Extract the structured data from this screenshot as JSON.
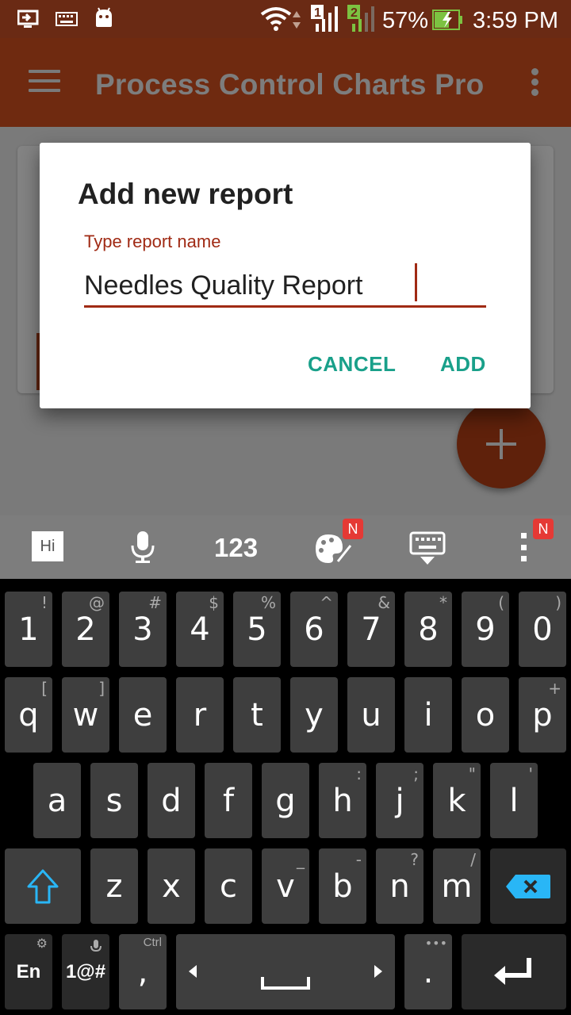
{
  "status_bar": {
    "battery_percent": "57%",
    "time": "3:59 PM",
    "sim1": "1",
    "sim2": "2",
    "icons": [
      "screen-cast-icon",
      "keyboard-icon",
      "android-icon",
      "wifi-icon",
      "signal-sim1-icon",
      "signal-sim2-icon",
      "battery-charging-icon"
    ]
  },
  "app_bar": {
    "title": "Process Control Charts Pro"
  },
  "dialog": {
    "title": "Add new report",
    "field_label": "Type report name",
    "field_value": "Needles Quality Report",
    "cancel_label": "CANCEL",
    "add_label": "ADD"
  },
  "keyboard_toolbar": {
    "hi_label": "Hi",
    "numbers_label": "123",
    "badge_new": "N"
  },
  "keyboard": {
    "row1": [
      {
        "main": "1",
        "sub": "!"
      },
      {
        "main": "2",
        "sub": "@"
      },
      {
        "main": "3",
        "sub": "#"
      },
      {
        "main": "4",
        "sub": "$"
      },
      {
        "main": "5",
        "sub": "%"
      },
      {
        "main": "6",
        "sub": "^"
      },
      {
        "main": "7",
        "sub": "&"
      },
      {
        "main": "8",
        "sub": "*"
      },
      {
        "main": "9",
        "sub": "("
      },
      {
        "main": "0",
        "sub": ")"
      }
    ],
    "row2": [
      {
        "main": "q",
        "sub": "["
      },
      {
        "main": "w",
        "sub": "]"
      },
      {
        "main": "e",
        "sub": ""
      },
      {
        "main": "r",
        "sub": ""
      },
      {
        "main": "t",
        "sub": ""
      },
      {
        "main": "y",
        "sub": ""
      },
      {
        "main": "u",
        "sub": ""
      },
      {
        "main": "i",
        "sub": ""
      },
      {
        "main": "o",
        "sub": ""
      },
      {
        "main": "p",
        "sub": "+"
      }
    ],
    "row3": [
      {
        "main": "a",
        "sub": ""
      },
      {
        "main": "s",
        "sub": ""
      },
      {
        "main": "d",
        "sub": ""
      },
      {
        "main": "f",
        "sub": ""
      },
      {
        "main": "g",
        "sub": ""
      },
      {
        "main": "h",
        "sub": ":"
      },
      {
        "main": "j",
        "sub": ";"
      },
      {
        "main": "k",
        "sub": "\""
      },
      {
        "main": "l",
        "sub": "'"
      }
    ],
    "row4": [
      {
        "main": "z",
        "sub": ""
      },
      {
        "main": "x",
        "sub": ""
      },
      {
        "main": "c",
        "sub": ""
      },
      {
        "main": "v",
        "sub": "_"
      },
      {
        "main": "b",
        "sub": "-"
      },
      {
        "main": "n",
        "sub": "?"
      },
      {
        "main": "m",
        "sub": "/"
      }
    ],
    "lang_label": "En",
    "symbols_label": "1@#",
    "ctrl_label": "Ctrl",
    "comma_label": ",",
    "period_label": ".",
    "accent_color": "#29b6f6"
  }
}
